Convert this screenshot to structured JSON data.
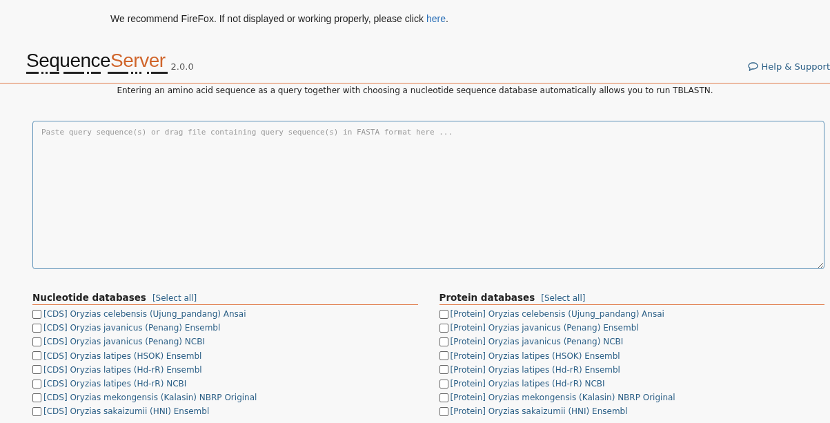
{
  "notice": {
    "text": "We recommend FireFox. If not displayed or working properly, please click",
    "link": "here",
    "end": "."
  },
  "header": {
    "logo_dark": "Sequence",
    "logo_accent": "Server",
    "version": "2.0.0",
    "help": "Help & Support"
  },
  "hint": "Entering an amino acid sequence as a query together with choosing a nucleotide sequence database automatically allows you to run TBLASTN.",
  "query": {
    "placeholder": "Paste query sequence(s) or drag file containing query sequence(s) in FASTA format here ..."
  },
  "databases": [
    {
      "title": "Nucleotide databases",
      "select_all": "[Select all]",
      "items": [
        {
          "label": "[CDS] Oryzias celebensis (Ujung_pandang) Ansai",
          "checked": false
        },
        {
          "label": "[CDS] Oryzias javanicus (Penang) Ensembl",
          "checked": false
        },
        {
          "label": "[CDS] Oryzias javanicus (Penang) NCBI",
          "checked": false
        },
        {
          "label": "[CDS] Oryzias latipes (HSOK) Ensembl",
          "checked": false
        },
        {
          "label": "[CDS] Oryzias latipes (Hd-rR) Ensembl",
          "checked": false
        },
        {
          "label": "[CDS] Oryzias latipes (Hd-rR) NCBI",
          "checked": false
        },
        {
          "label": "[CDS] Oryzias mekongensis (Kalasin) NBRP Original",
          "checked": false
        },
        {
          "label": "[CDS] Oryzias sakaizumii (HNI) Ensembl",
          "checked": false
        }
      ]
    },
    {
      "title": "Protein databases",
      "select_all": "[Select all]",
      "items": [
        {
          "label": "[Protein] Oryzias celebensis (Ujung_pandang) Ansai",
          "checked": false
        },
        {
          "label": "[Protein] Oryzias javanicus (Penang) Ensembl",
          "checked": false
        },
        {
          "label": "[Protein] Oryzias javanicus (Penang) NCBI",
          "checked": false
        },
        {
          "label": "[Protein] Oryzias latipes (HSOK) Ensembl",
          "checked": false
        },
        {
          "label": "[Protein] Oryzias latipes (Hd-rR) Ensembl",
          "checked": false
        },
        {
          "label": "[Protein] Oryzias latipes (Hd-rR) NCBI",
          "checked": false
        },
        {
          "label": "[Protein] Oryzias mekongensis (Kalasin) NBRP Original",
          "checked": false
        },
        {
          "label": "[Protein] Oryzias sakaizumii (HNI) Ensembl",
          "checked": false
        }
      ]
    }
  ]
}
